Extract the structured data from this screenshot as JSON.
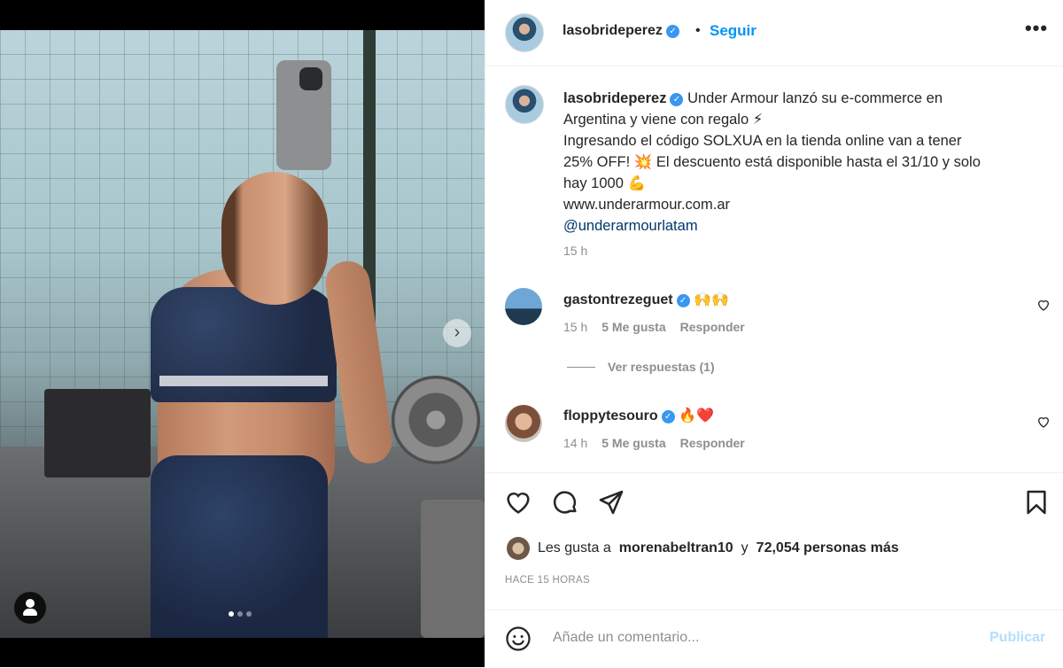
{
  "post": {
    "username": "lasobrideperez",
    "follow_label": "Seguir",
    "bullet": "•",
    "more_label": "•••",
    "caption": {
      "line1": "Under Armour lanzó su e-commerce en",
      "line2": "Argentina y viene con regalo ⚡",
      "line3": "Ingresando el código SOLXUA en la tienda online van a tener",
      "line4": "25% OFF! 💥 El descuento está disponible hasta el 31/10 y solo",
      "line5": "hay 1000 💪",
      "line6": "www.underarmour.com.ar",
      "line7": "@underarmourlatam"
    },
    "caption_time": "15 h",
    "comments": [
      {
        "username": "gastontrezeguet",
        "text": "🙌🙌",
        "time": "15 h",
        "likes": "5 Me gusta",
        "reply": "Responder"
      },
      {
        "username": "floppytesouro",
        "text": "🔥❤️",
        "time": "14 h",
        "likes": "5 Me gusta",
        "reply": "Responder"
      }
    ],
    "view_replies": "Ver respuestas (1)",
    "likes": {
      "prefix": "Les gusta a",
      "user": "morenabeltran10",
      "connector": "y",
      "count": "72,054 personas más"
    },
    "timestamp": "HACE 15 HORAS",
    "add_comment_placeholder": "Añade un comentario...",
    "publish_label": "Publicar"
  },
  "media": {
    "slide_count": 3,
    "active_slide": 1
  },
  "colors": {
    "accent": "#0095f6",
    "verified": "#3897f0",
    "muted": "#8e8e8e",
    "text": "#262626"
  }
}
